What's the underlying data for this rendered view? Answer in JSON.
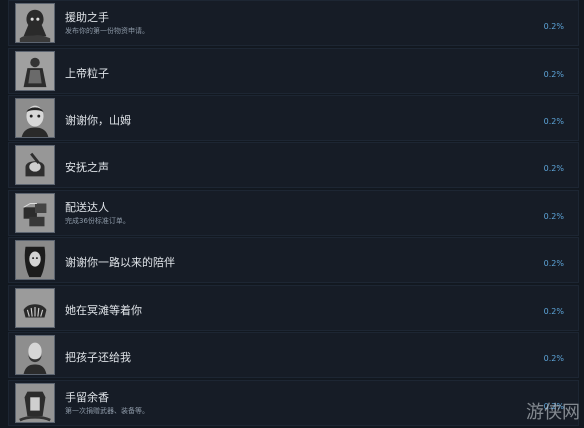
{
  "achievements": [
    {
      "title": "援助之手",
      "desc": "发布你的第一份物资申请。",
      "percent": "0.2%",
      "icon": "hooded-figure-icon"
    },
    {
      "title": "上帝粒子",
      "desc": "",
      "percent": "0.2%",
      "icon": "robed-figure-icon"
    },
    {
      "title": "谢谢你，山姆",
      "desc": "",
      "percent": "0.2%",
      "icon": "face-portrait-icon"
    },
    {
      "title": "安抚之声",
      "desc": "",
      "percent": "0.2%",
      "icon": "baby-pod-icon"
    },
    {
      "title": "配送达人",
      "desc": "完成36份标准订单。",
      "percent": "0.2%",
      "icon": "cargo-crate-icon"
    },
    {
      "title": "谢谢你一路以来的陪伴",
      "desc": "",
      "percent": "0.2%",
      "icon": "long-hair-portrait-icon"
    },
    {
      "title": "她在冥滩等着你",
      "desc": "",
      "percent": "0.2%",
      "icon": "shell-icon"
    },
    {
      "title": "把孩子还给我",
      "desc": "",
      "percent": "0.2%",
      "icon": "bearded-portrait-icon"
    },
    {
      "title": "手留余香",
      "desc": "第一次捐赠武器、装备等。",
      "percent": "0.2%",
      "icon": "container-icon"
    }
  ],
  "watermark": "游侠网"
}
